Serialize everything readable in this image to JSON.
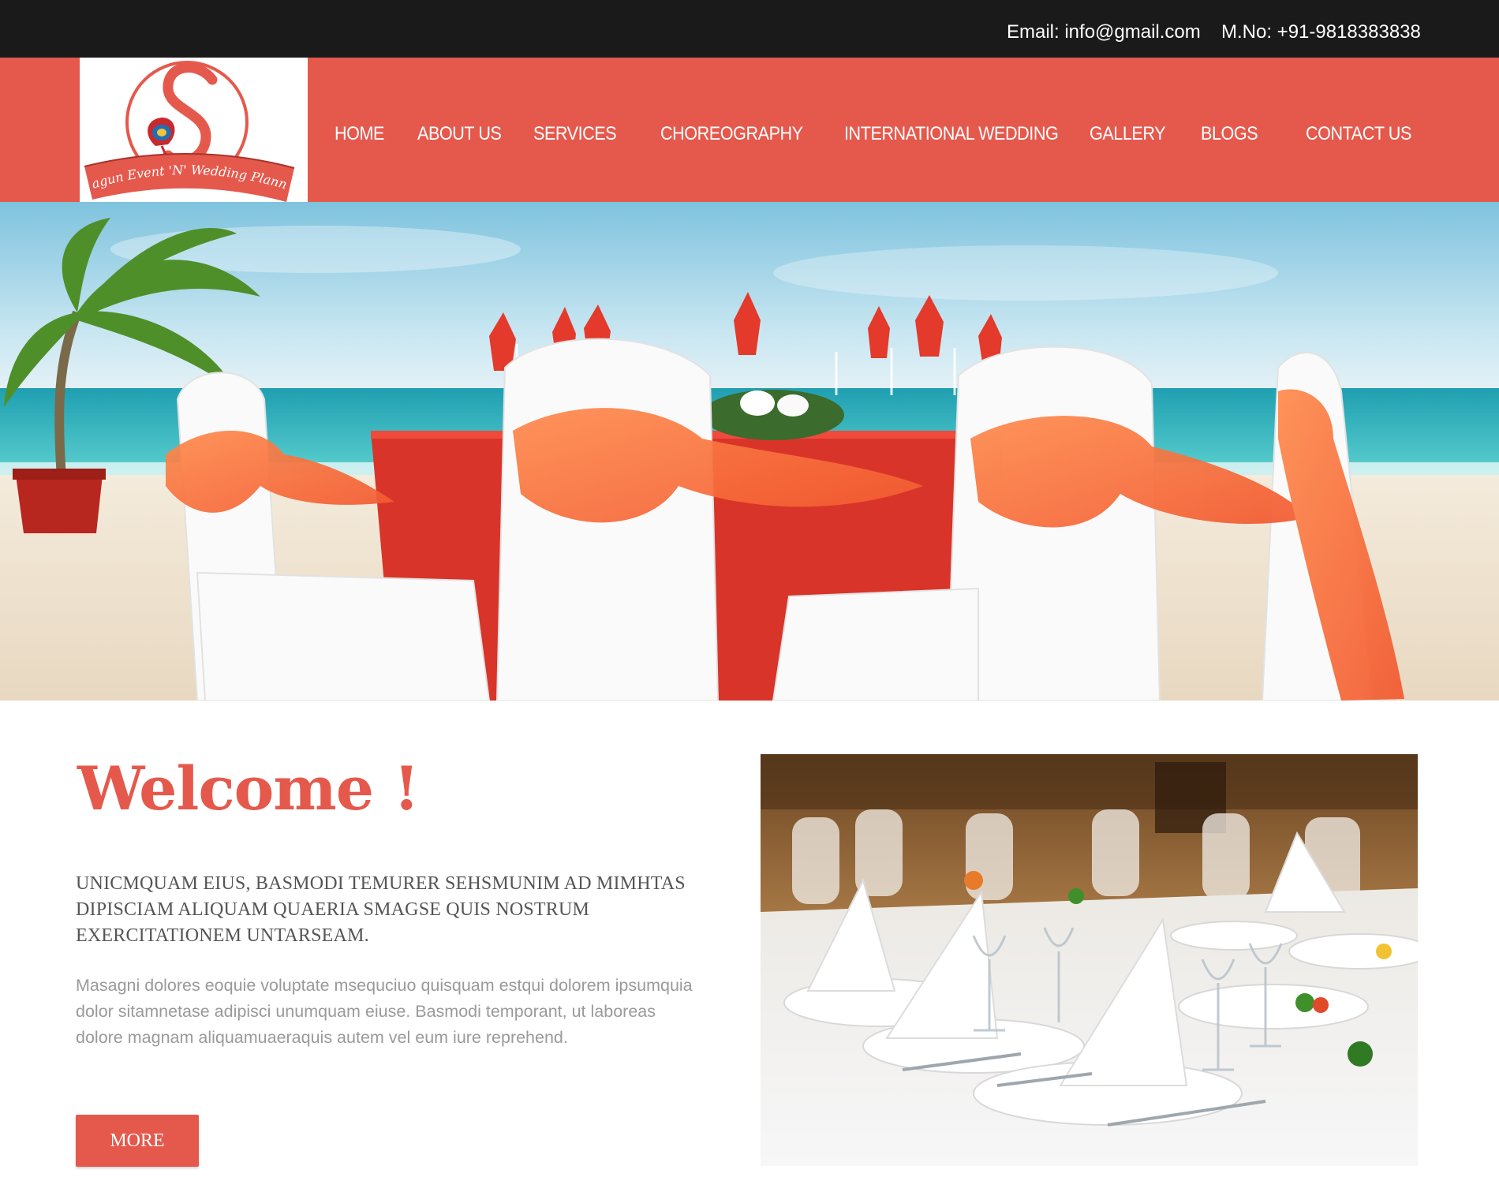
{
  "topbar": {
    "email": "Email: info@gmail.com",
    "phone": "M.No: +91-9818383838"
  },
  "logo": {
    "brand_text": "Shagun Event 'N' Wedding Planners",
    "monogram": "S",
    "icon": "peacock-feather-icon"
  },
  "nav": {
    "items": [
      {
        "label": "HOME"
      },
      {
        "label": "ABOUT US"
      },
      {
        "label": "SERVICES"
      },
      {
        "label": "CHOREOGRAPHY"
      },
      {
        "label": "INTERNATIONAL WEDDING"
      },
      {
        "label": "GALLERY"
      },
      {
        "label": "BLOGS"
      },
      {
        "label": "CONTACT  US"
      }
    ]
  },
  "welcome": {
    "title": "Welcome !",
    "lead": "UNICMQUAM EIUS, BASMODI TEMURER SEHSMUNIM AD MIMHTAS DIPISCIAM ALIQUAM QUAERIA SMAGSE QUIS NOSTRUM EXERCITATIONEM UNTARSEAM.",
    "body": "Masagni dolores eoquie voluptate msequciuo quisquam estqui dolorem ipsumquia dolor sitamnetase adipisci unumquam eiuse. Basmodi temporant, ut laboreas dolore magnam aliquamuaeraquis autem vel eum iure reprehend.",
    "more_label": "MORE"
  },
  "colors": {
    "accent": "#e5594d",
    "topbar": "#1a1a1a",
    "heading_text": "#555555",
    "body_text": "#9a9a9a"
  }
}
